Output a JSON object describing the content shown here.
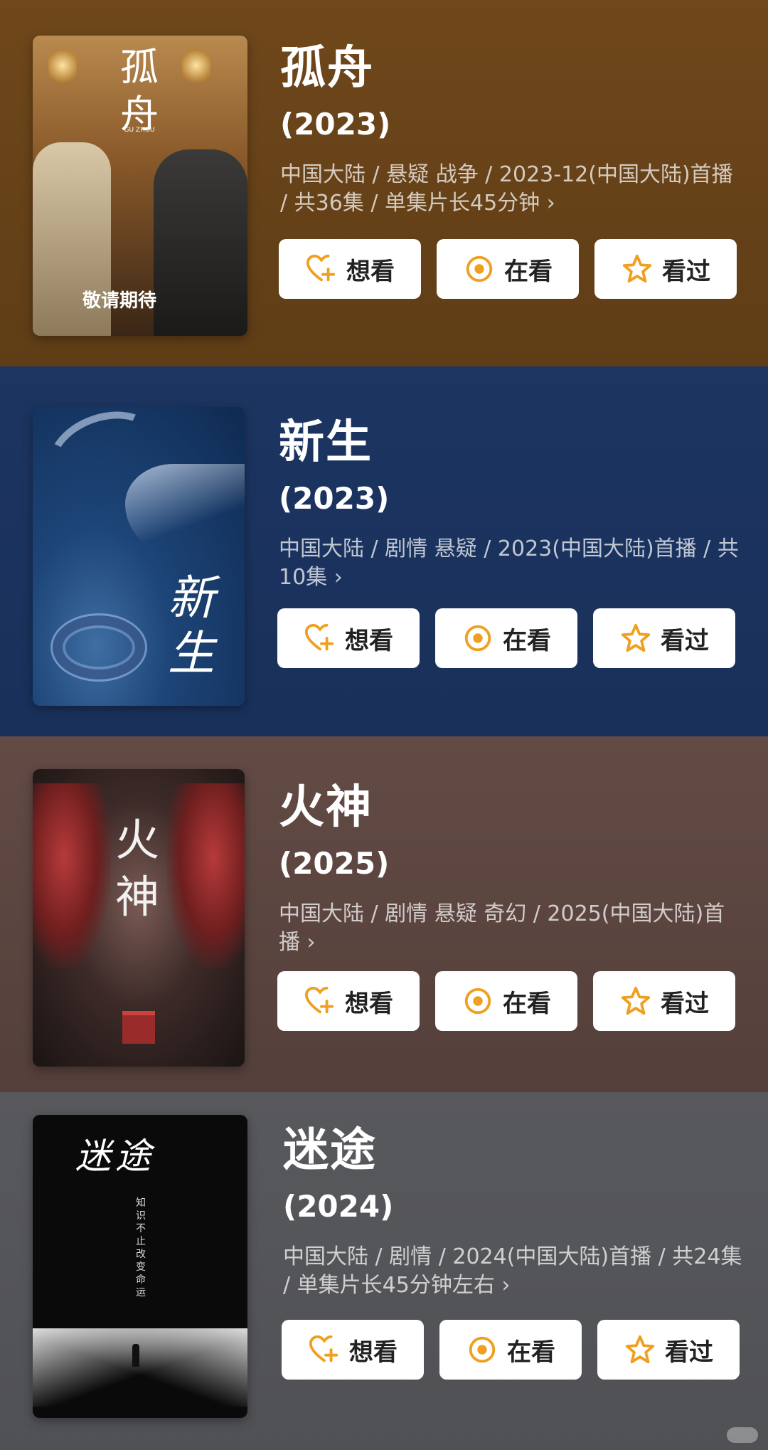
{
  "buttons": {
    "want": "想看",
    "watching": "在看",
    "watched": "看过"
  },
  "items": [
    {
      "title": "孤舟",
      "year": "(2023)",
      "meta": "中国大陆 / 悬疑 战争 / 2023-12(中国大陆)首播 / 共36集 / 单集片长45分钟 ›",
      "poster_title": "孤\n舟",
      "poster_sub": "GU ZHOU",
      "poster_tag": "敬请期待",
      "bg": "#6a4419"
    },
    {
      "title": "新生",
      "year": "(2023)",
      "meta": "中国大陆 / 剧情 悬疑 / 2023(中国大陆)首播 / 共10集 ›",
      "poster_title": "新\n生",
      "bg": "#1e355f"
    },
    {
      "title": "火神",
      "year": "(2025)",
      "meta": "中国大陆 / 剧情 悬疑 奇幻 / 2025(中国大陆)首播 ›",
      "poster_title": "火\n神",
      "bg": "#5c4540"
    },
    {
      "title": "迷途",
      "year": "(2024)",
      "meta": "中国大陆 / 剧情 / 2024(中国大陆)首播 / 共24集 / 单集片长45分钟左右 ›",
      "poster_title": "迷途",
      "poster_sub": "知识 不止改变命运",
      "bg": "#57585c"
    }
  ],
  "colors": {
    "accent": "#f0a020"
  }
}
